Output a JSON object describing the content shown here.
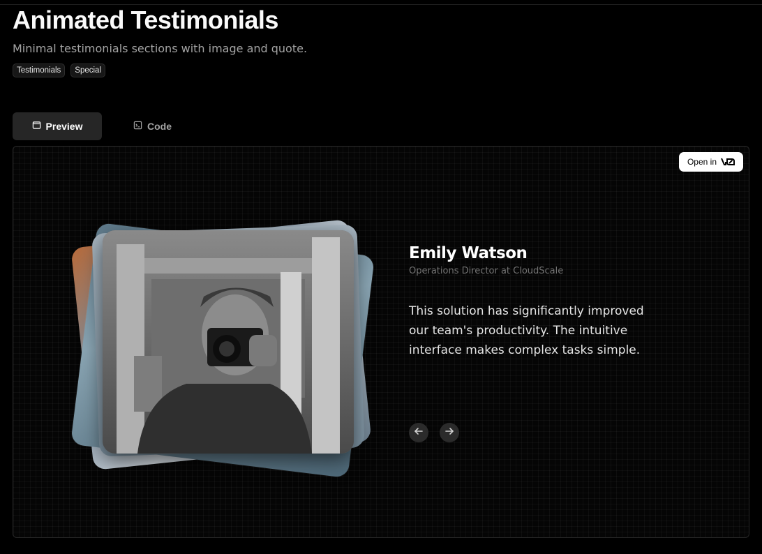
{
  "page": {
    "title": "Animated Testimonials",
    "subtitle": "Minimal testimonials sections with image and quote.",
    "tags": [
      "Testimonials",
      "Special"
    ]
  },
  "tabs": [
    {
      "label": "Preview",
      "icon": "window-icon",
      "active": true
    },
    {
      "label": "Code",
      "icon": "terminal-icon",
      "active": false
    }
  ],
  "preview": {
    "open_in_label": "Open in",
    "open_in_logo": "v0",
    "testimonial": {
      "name": "Emily Watson",
      "role": "Operations Director at CloudScale",
      "quote": "This solution has significantly improved our team's productivity. The intuitive interface makes complex tasks simple."
    },
    "nav": {
      "prev_icon": "arrow-left-icon",
      "next_icon": "arrow-right-icon"
    }
  },
  "colors": {
    "background": "#000000",
    "tab_active_bg": "#262626",
    "muted_text": "#a3a3a3",
    "role_text": "#737373",
    "nav_button_bg": "#2b2b2b"
  }
}
